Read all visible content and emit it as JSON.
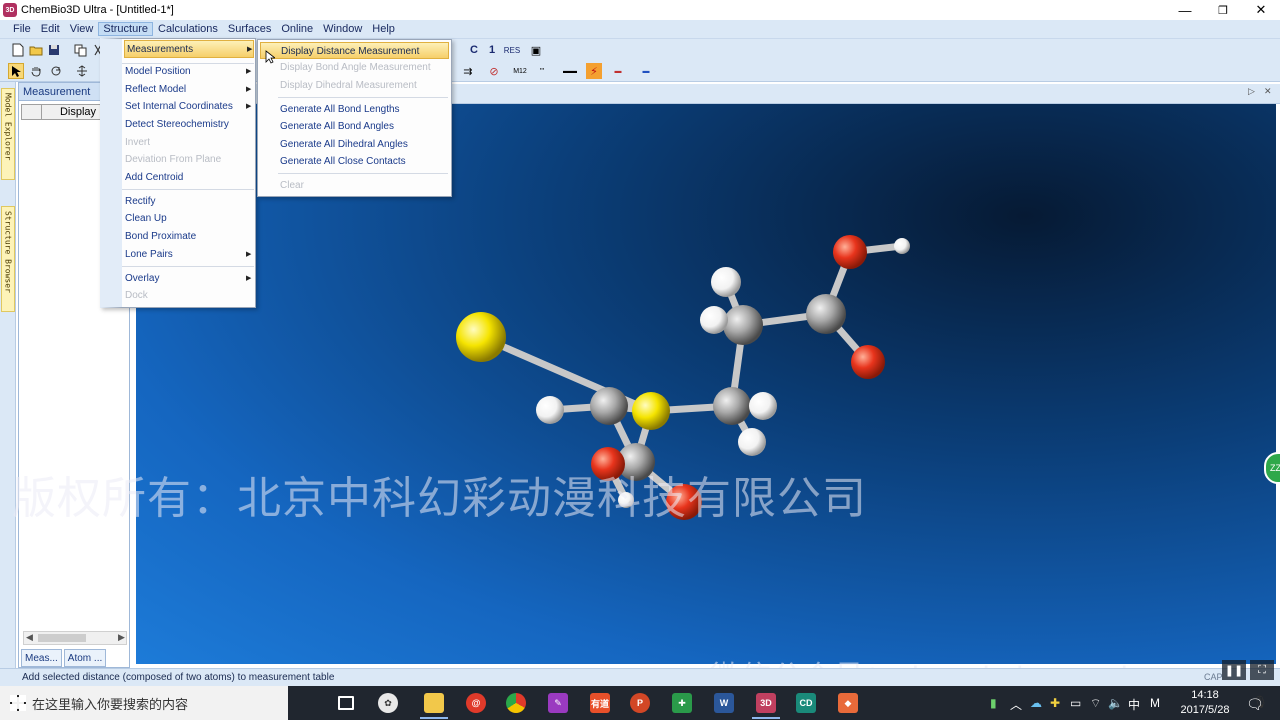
{
  "window": {
    "app_icon": "3D",
    "title": "ChemBio3D Ultra - [Untitled-1*]",
    "controls": [
      "—",
      "❐",
      "✕"
    ]
  },
  "menubar": {
    "items": [
      "File",
      "Edit",
      "View",
      "Structure",
      "Calculations",
      "Surfaces",
      "Online",
      "Window",
      "Help"
    ],
    "active": "Structure"
  },
  "toolbar1": {
    "icons": [
      "new-document-icon",
      "open-folder-icon",
      "save-icon",
      "copy-icon",
      "cut-icon"
    ],
    "right_labels": [
      "C",
      "1",
      "RES",
      "▣"
    ]
  },
  "toolbar2": {
    "right_labels": [
      "⇉",
      "⊘",
      "M12",
      "'''",
      "▬▬",
      "▬▬",
      "⚡",
      "▬",
      "▬"
    ]
  },
  "structure_menu": {
    "items": [
      {
        "label": "Measurements",
        "submenu": true,
        "highlight": true
      },
      {
        "label": "Model Position",
        "submenu": true
      },
      {
        "label": "Reflect Model",
        "submenu": true
      },
      {
        "label": "Set Internal Coordinates",
        "submenu": true
      },
      {
        "label": "Detect Stereochemistry"
      },
      {
        "label": "Invert",
        "disabled": true
      },
      {
        "label": "Deviation From Plane",
        "disabled": true
      },
      {
        "label": "Add Centroid"
      },
      {
        "label": "Rectify"
      },
      {
        "label": "Clean Up"
      },
      {
        "label": "Bond Proximate"
      },
      {
        "label": "Lone Pairs",
        "submenu": true
      },
      {
        "label": "Overlay",
        "submenu": true
      },
      {
        "label": "Dock",
        "disabled": true
      }
    ]
  },
  "measurements_submenu": {
    "items": [
      {
        "label": "Display Distance Measurement",
        "highlight": true
      },
      {
        "label": "Display Bond Angle Measurement",
        "disabled": true
      },
      {
        "label": "Display Dihedral Measurement",
        "disabled": true
      },
      {
        "label": "Generate All Bond Lengths"
      },
      {
        "label": "Generate All Bond Angles"
      },
      {
        "label": "Generate All Dihedral Angles"
      },
      {
        "label": "Generate All Close Contacts"
      },
      {
        "label": "Clear",
        "disabled": true
      }
    ]
  },
  "left_tabs": [
    "Model Explorer",
    "Structure Browser"
  ],
  "measurement_panel": {
    "title": "Measurement",
    "column_header": "Display",
    "tabs": [
      "Meas...",
      "Atom ..."
    ]
  },
  "viewport": {
    "background": "#1566c0",
    "atom_colors": {
      "carbon": "#a9a9a9",
      "hydrogen": "#f2f2f2",
      "oxygen": "#e8341c",
      "sulfur": "#f5e400"
    }
  },
  "watermarks": {
    "line1": "版权所有：北京中科幻彩动漫科技有限公司",
    "line2": "微信公众号：zhongkehuancai"
  },
  "zz_badge": "ZZ",
  "status": {
    "text": "Add selected distance (composed of two atoms) to measurement table",
    "indicator": "CAP"
  },
  "video_controls": [
    "❚❚",
    "⛶"
  ],
  "taskbar": {
    "search_placeholder": "在这里输入你要搜索的内容",
    "apps": [
      "task-view",
      "pinwheel",
      "file-explorer",
      "163-mail",
      "chrome",
      "paint",
      "netease",
      "powerpoint",
      "cad",
      "word",
      "chembio3d",
      "chemdraw",
      "slides"
    ],
    "tray_lang": "中",
    "tray_ime": "M",
    "time": "14:18",
    "date": "2017/5/28"
  }
}
